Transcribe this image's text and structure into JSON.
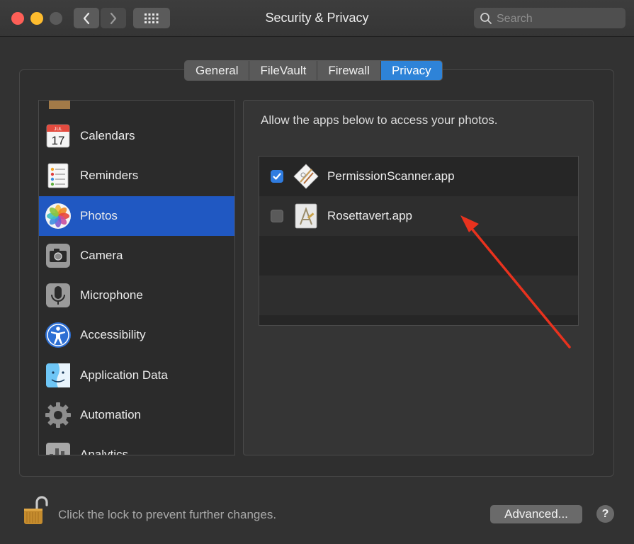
{
  "window": {
    "title": "Security & Privacy"
  },
  "search": {
    "placeholder": "Search",
    "value": ""
  },
  "tabs": [
    {
      "label": "General",
      "active": false
    },
    {
      "label": "FileVault",
      "active": false
    },
    {
      "label": "Firewall",
      "active": false
    },
    {
      "label": "Privacy",
      "active": true
    }
  ],
  "sidebar": {
    "items": [
      {
        "label": "Calendars",
        "icon": "calendar-icon",
        "icon_month": "JUL",
        "icon_day": "17",
        "selected": false
      },
      {
        "label": "Reminders",
        "icon": "reminders-icon",
        "selected": false
      },
      {
        "label": "Photos",
        "icon": "photos-icon",
        "selected": true
      },
      {
        "label": "Camera",
        "icon": "camera-icon",
        "selected": false
      },
      {
        "label": "Microphone",
        "icon": "microphone-icon",
        "selected": false
      },
      {
        "label": "Accessibility",
        "icon": "accessibility-icon",
        "selected": false
      },
      {
        "label": "Application Data",
        "icon": "finder-icon",
        "selected": false
      },
      {
        "label": "Automation",
        "icon": "gear-icon",
        "selected": false
      },
      {
        "label": "Analytics",
        "icon": "analytics-icon",
        "selected": false
      }
    ]
  },
  "panel": {
    "description": "Allow the apps below to access your photos.",
    "apps": [
      {
        "name": "PermissionScanner.app",
        "checked": true,
        "icon": "permission-scanner-icon"
      },
      {
        "name": "Rosettavert.app",
        "checked": false,
        "icon": "rosettavert-icon"
      }
    ]
  },
  "footer": {
    "lock_text": "Click the lock to prevent further changes.",
    "advanced_label": "Advanced...",
    "help_label": "?"
  },
  "colors": {
    "selection": "#2058c2",
    "active_tab": "#2e83d8",
    "checkbox_checked": "#2f7ce0",
    "annotation_arrow": "#e8321e"
  }
}
